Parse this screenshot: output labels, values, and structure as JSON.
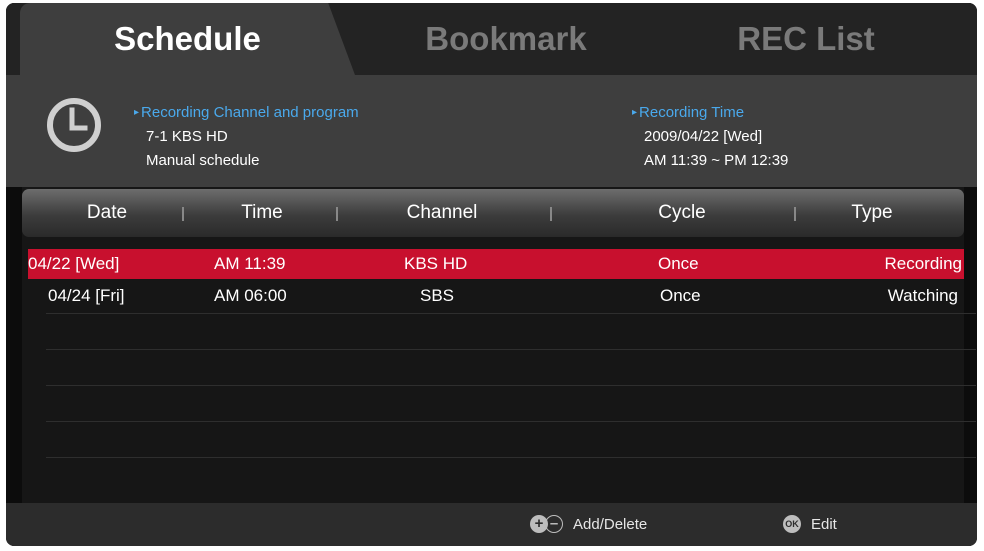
{
  "tabs": [
    {
      "label": "Schedule",
      "active": true
    },
    {
      "label": "Bookmark",
      "active": false
    },
    {
      "label": "REC List",
      "active": false
    }
  ],
  "info": {
    "channel_label": "Recording Channel and program",
    "channel_value": "7-1 KBS HD",
    "program_value": "Manual schedule",
    "time_label": "Recording Time",
    "date_value": "2009/04/22 [Wed]",
    "time_value": "AM 11:39 ~ PM 12:39",
    "clock_icon": "clock-icon"
  },
  "table": {
    "columns": [
      "Date",
      "Time",
      "Channel",
      "Cycle",
      "Type"
    ],
    "rows": [
      {
        "date": "04/22 [Wed]",
        "time": "AM 11:39",
        "channel": "KBS HD",
        "cycle": "Once",
        "type": "Recording",
        "selected": true
      },
      {
        "date": "04/24 [Fri]",
        "time": "AM 06:00",
        "channel": "SBS",
        "cycle": "Once",
        "type": "Watching",
        "selected": false
      }
    ]
  },
  "footer": {
    "add_delete_label": "Add/Delete",
    "ok_badge": "OK",
    "edit_label": "Edit"
  },
  "colors": {
    "accent": "#4aa9ec",
    "selected_row": "#c8102e"
  }
}
